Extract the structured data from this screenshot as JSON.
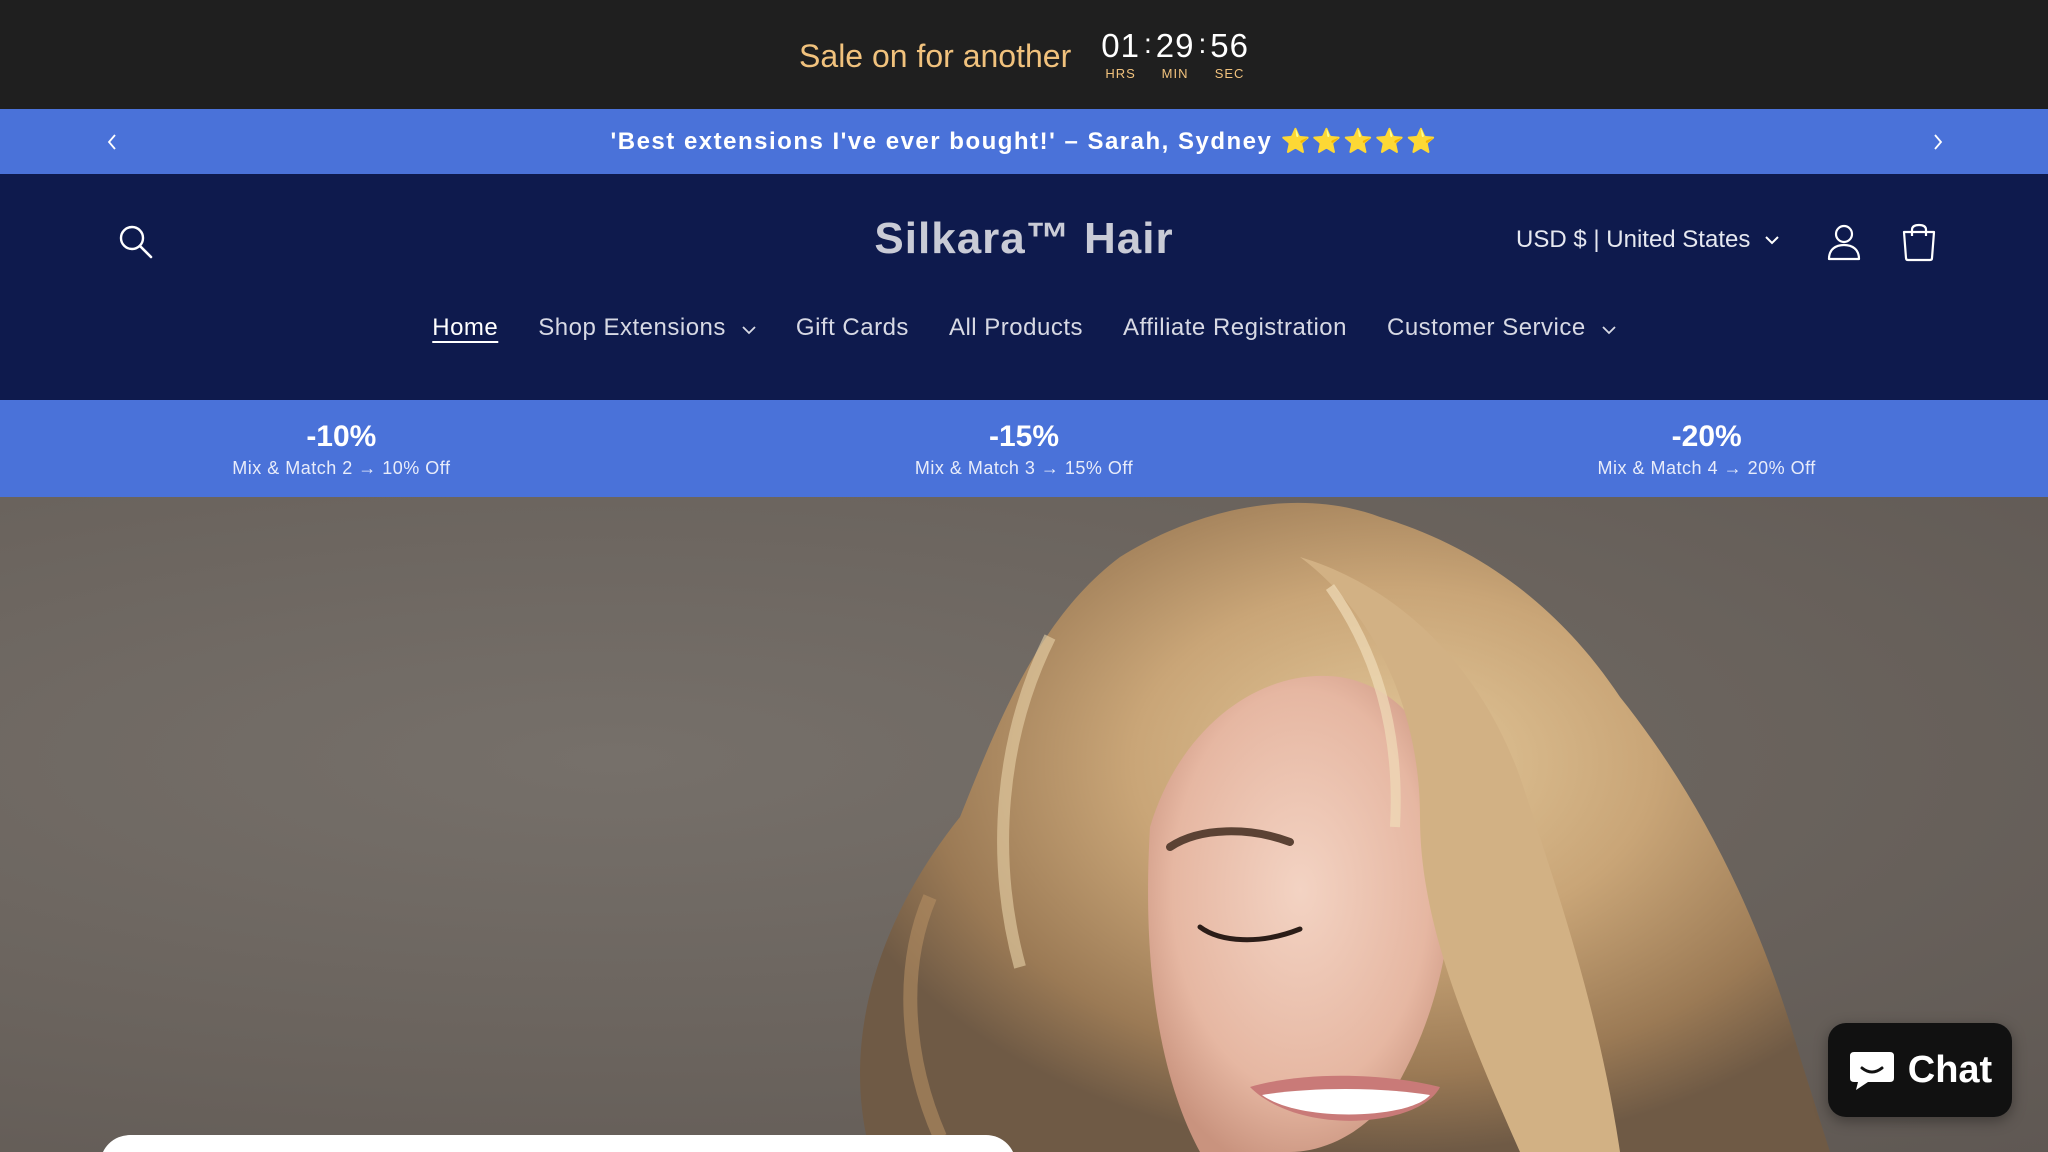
{
  "countdown": {
    "text": "Sale on for another",
    "hours": "01",
    "hours_label": "HRS",
    "minutes": "29",
    "minutes_label": "MIN",
    "seconds": "56",
    "seconds_label": "SEC",
    "separator": ":"
  },
  "announcement": {
    "text": "'Best extensions I've ever bought!' – Sarah, Sydney ⭐⭐⭐⭐⭐",
    "prev_icon": "chevron-left-icon",
    "next_icon": "chevron-right-icon"
  },
  "header": {
    "brand": "Silkara™ Hair",
    "currency": "USD $ | United States",
    "icons": [
      "search-icon",
      "account-icon",
      "cart-icon"
    ]
  },
  "nav": {
    "items": [
      {
        "label": "Home",
        "active": true
      },
      {
        "label": "Shop Extensions",
        "has_dropdown": true
      },
      {
        "label": "Gift Cards"
      },
      {
        "label": "All Products"
      },
      {
        "label": "Affiliate Registration"
      },
      {
        "label": "Customer Service",
        "has_dropdown": true
      }
    ]
  },
  "discounts": [
    {
      "pct": "-10%",
      "desc": "Mix & Match 2 → 10% Off"
    },
    {
      "pct": "-15%",
      "desc": "Mix & Match 3 → 15% Off"
    },
    {
      "pct": "-20%",
      "desc": "Mix & Match 4 → 20% Off"
    }
  ],
  "chat": {
    "label": "Chat",
    "icon": "chat-bubble-icon"
  },
  "colors": {
    "countdown_bg": "#1f1f1f",
    "countdown_accent": "#f1c27d",
    "announcement_bg": "#4a72d9",
    "header_bg": "#0e1a4d",
    "chat_bg": "#111111"
  }
}
